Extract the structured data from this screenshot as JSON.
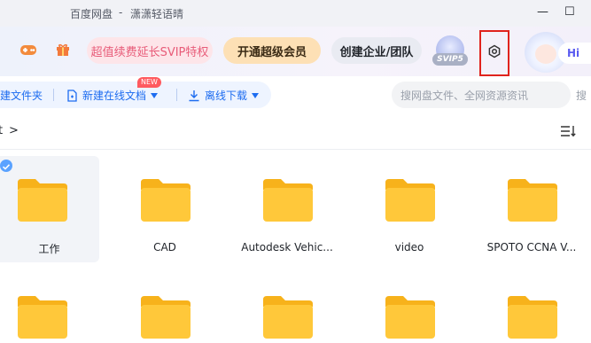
{
  "window": {
    "app_name": "百度网盘",
    "separator": "-",
    "user_name": "潇潇轻语晴",
    "minimize": "—",
    "maximize": "☐"
  },
  "header": {
    "game_icon": "gamepad-icon",
    "gift_icon": "gift-icon",
    "svip_extend": "超值续费延长SVIP特权",
    "open_vip": "开通超级会员",
    "enterprise": "创建企业/团队",
    "svip_level": "SVIP5",
    "hi_label": "Hi"
  },
  "toolbar": {
    "new_folder": "建文件夹",
    "new_online_doc": "新建在线文档",
    "new_badge": "NEW",
    "offline_download": "离线下载",
    "search_placeholder": "搜网盘文件、全网资源资讯",
    "search_next": "搜"
  },
  "breadcrumb": {
    "current": "t",
    "arrow": ">"
  },
  "files": [
    {
      "name": "工作"
    },
    {
      "name": "CAD"
    },
    {
      "name": "Autodesk Vehic..."
    },
    {
      "name": "video"
    },
    {
      "name": "SPOTO CCNA V..."
    },
    {
      "name": ""
    },
    {
      "name": ""
    },
    {
      "name": ""
    },
    {
      "name": ""
    },
    {
      "name": ""
    }
  ],
  "colors": {
    "accent_blue": "#1d6cf0",
    "folder_yellow": "#ffc83a",
    "highlight_red": "#e0231d"
  }
}
